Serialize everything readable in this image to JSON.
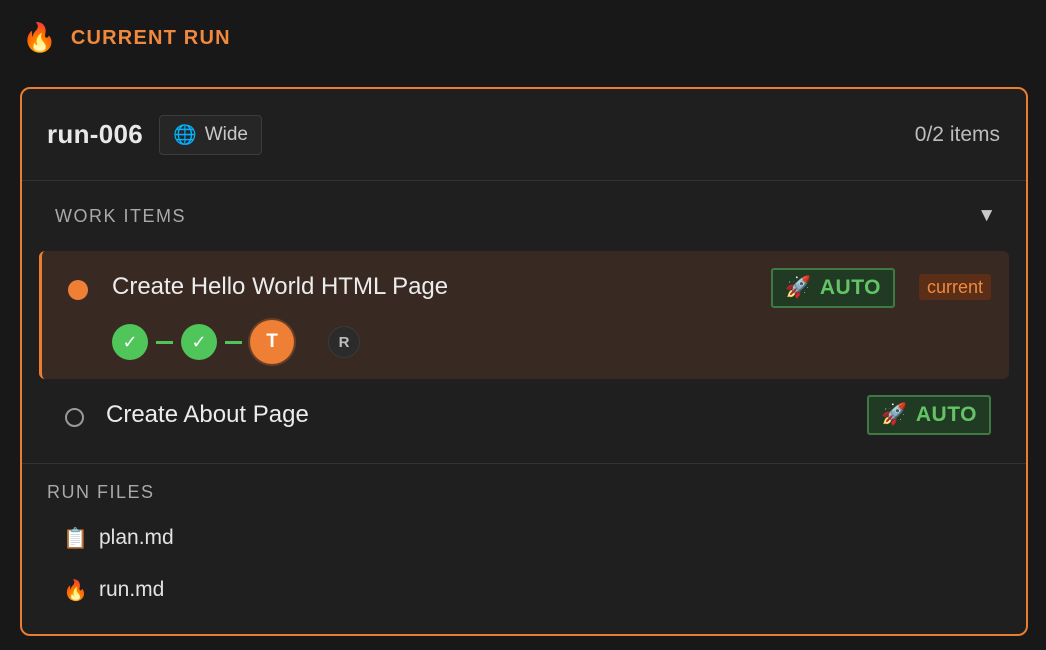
{
  "header": {
    "icon": "flame-icon",
    "title": "CURRENT RUN"
  },
  "run": {
    "id": "run-006",
    "scope": {
      "icon": "globe-icon",
      "label": "Wide"
    },
    "item_count": "0/2 items"
  },
  "work_items_section": {
    "label": "WORK ITEMS",
    "toggle": "▼",
    "items": [
      {
        "title": "Create Hello World HTML Page",
        "mode": {
          "icon": "rocket-icon",
          "label": "AUTO"
        },
        "tag": "current",
        "steps": [
          {
            "label": "✓",
            "state": "done"
          },
          {
            "label": "✓",
            "state": "done"
          },
          {
            "label": "T",
            "state": "active"
          },
          {
            "label": "R",
            "state": "todo"
          }
        ]
      },
      {
        "title": "Create About Page",
        "mode": {
          "icon": "rocket-icon",
          "label": "AUTO"
        }
      }
    ]
  },
  "run_files": {
    "label": "RUN FILES",
    "files": [
      {
        "icon": "clipboard-icon",
        "name": "plan.md"
      },
      {
        "icon": "flame-icon",
        "name": "run.md"
      }
    ]
  },
  "colors": {
    "accent": "#e97d30",
    "success": "#4fc55a",
    "background": "#181818"
  }
}
